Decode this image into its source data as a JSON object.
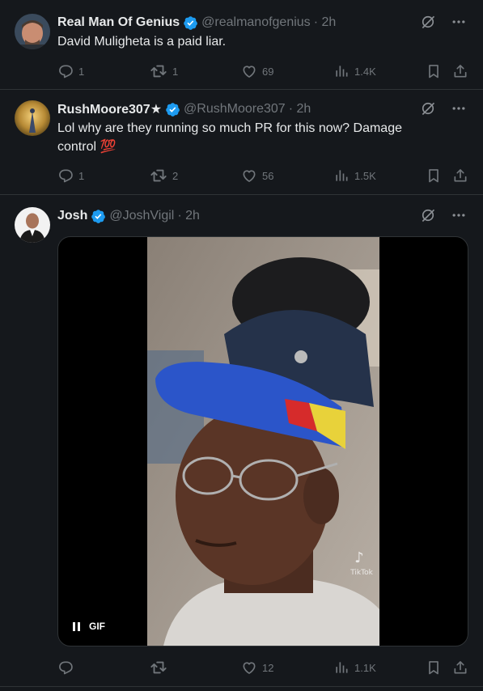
{
  "tweets": [
    {
      "name": "Real Man Of Genius",
      "handle": "@realmanofgenius",
      "time": "· 2h",
      "text": "David Muligheta is a paid liar.",
      "replies": "1",
      "retweets": "1",
      "likes": "69",
      "views": "1.4K"
    },
    {
      "name": "RushMoore307★",
      "handle": "@RushMoore307",
      "time": "· 2h",
      "text": "Lol why are they running so much PR for this now? Damage control 💯",
      "replies": "1",
      "retweets": "2",
      "likes": "56",
      "views": "1.5K"
    },
    {
      "name": "Josh",
      "handle": "@JoshVigil",
      "time": "· 2h",
      "replies": "",
      "retweets": "",
      "likes": "12",
      "views": "1.1K",
      "media": {
        "gif_label": "GIF",
        "watermark": "TikTok"
      }
    }
  ],
  "icons": {
    "verified": "verified-badge-icon",
    "grok": "grok-icon",
    "more": "more-icon",
    "reply": "reply-icon",
    "retweet": "retweet-icon",
    "like": "like-icon",
    "views": "views-icon",
    "bookmark": "bookmark-icon",
    "share": "share-icon"
  },
  "colors": {
    "background": "#15181c",
    "verified": "#1d9bf0",
    "secondary": "#71767b"
  }
}
